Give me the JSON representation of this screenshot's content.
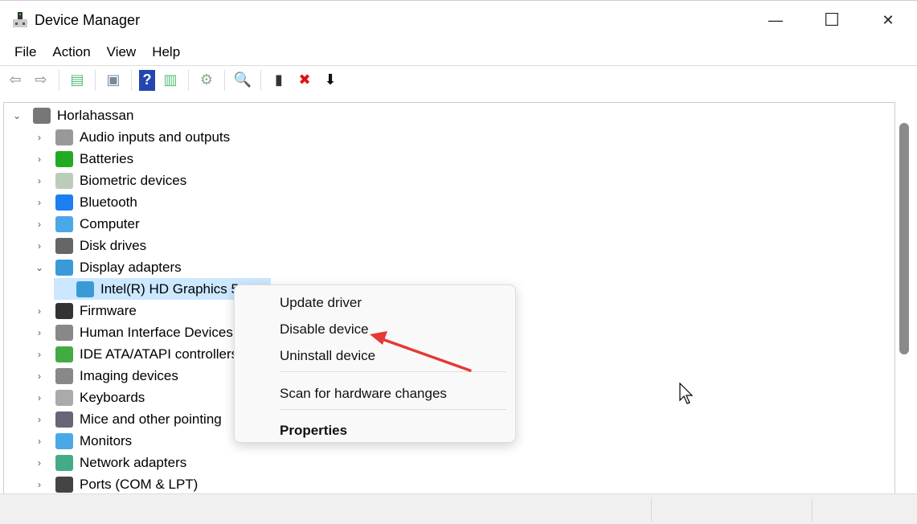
{
  "window": {
    "title": "Device Manager",
    "minimize": "—",
    "maximize": "☐",
    "close": "✕"
  },
  "menu": [
    "File",
    "Action",
    "View",
    "Help"
  ],
  "toolbar": [
    {
      "name": "back-icon",
      "glyph": "⇦",
      "color": "#888"
    },
    {
      "name": "forward-icon",
      "glyph": "⇨",
      "color": "#888"
    },
    {
      "sep": true
    },
    {
      "name": "show-hide-console-tree-icon",
      "glyph": "▤",
      "color": "#5b7"
    },
    {
      "sep": true
    },
    {
      "name": "properties-icon",
      "glyph": "▣",
      "color": "#789"
    },
    {
      "sep": true
    },
    {
      "name": "help-icon",
      "glyph": "?",
      "color": "#fff",
      "bg": "#2346b0"
    },
    {
      "name": "action-pane-icon",
      "glyph": "▥",
      "color": "#5b7"
    },
    {
      "sep": true
    },
    {
      "name": "update-driver-icon",
      "glyph": "⚙",
      "color": "#8a8"
    },
    {
      "sep": true
    },
    {
      "name": "scan-hardware-icon",
      "glyph": "🔍",
      "color": "#39c"
    },
    {
      "sep": true
    },
    {
      "name": "enable-device-icon",
      "glyph": "▮",
      "color": "#333"
    },
    {
      "name": "uninstall-device-icon",
      "glyph": "✖",
      "color": "#e01010"
    },
    {
      "name": "disable-device-icon",
      "glyph": "⬇",
      "color": "#111"
    }
  ],
  "tree": {
    "root": {
      "label": "Horlahassan",
      "icon": "computer-root-icon",
      "color": "#777"
    },
    "items": [
      {
        "label": "Audio inputs and outputs",
        "icon": "speaker-icon",
        "color": "#999",
        "expanded": false
      },
      {
        "label": "Batteries",
        "icon": "battery-icon",
        "color": "#2a2",
        "expanded": false
      },
      {
        "label": "Biometric devices",
        "icon": "fingerprint-icon",
        "color": "#bcb",
        "expanded": false
      },
      {
        "label": "Bluetooth",
        "icon": "bluetooth-icon",
        "color": "#1a7ff0",
        "expanded": false
      },
      {
        "label": "Computer",
        "icon": "monitor-icon",
        "color": "#4aa8e8",
        "expanded": false
      },
      {
        "label": "Disk drives",
        "icon": "disk-drive-icon",
        "color": "#666",
        "expanded": false
      },
      {
        "label": "Display adapters",
        "icon": "display-adapter-icon",
        "color": "#3a9ad8",
        "expanded": true
      },
      {
        "label": "Intel(R) HD Graphics 5",
        "icon": "display-adapter-icon",
        "color": "#3a9ad8",
        "child": true,
        "selected": true
      },
      {
        "label": "Firmware",
        "icon": "chip-icon",
        "color": "#333",
        "expanded": false
      },
      {
        "label": "Human Interface Devices",
        "icon": "hid-icon",
        "color": "#888",
        "expanded": false
      },
      {
        "label": "IDE ATA/ATAPI controllers",
        "icon": "controller-icon",
        "color": "#4a4",
        "expanded": false
      },
      {
        "label": "Imaging devices",
        "icon": "camera-icon",
        "color": "#888",
        "expanded": false
      },
      {
        "label": "Keyboards",
        "icon": "keyboard-icon",
        "color": "#aaa",
        "expanded": false
      },
      {
        "label": "Mice and other pointing",
        "icon": "mouse-icon",
        "color": "#667",
        "expanded": false
      },
      {
        "label": "Monitors",
        "icon": "monitor-icon",
        "color": "#4aa8e8",
        "expanded": false
      },
      {
        "label": "Network adapters",
        "icon": "network-icon",
        "color": "#4a8",
        "expanded": false
      },
      {
        "label": "Ports (COM & LPT)",
        "icon": "port-icon",
        "color": "#444",
        "expanded": false
      }
    ]
  },
  "context_menu": {
    "items": [
      "Update driver",
      "Disable device",
      "Uninstall device",
      "Scan for hardware changes",
      "Properties"
    ],
    "arrow_color": "#e53935"
  }
}
